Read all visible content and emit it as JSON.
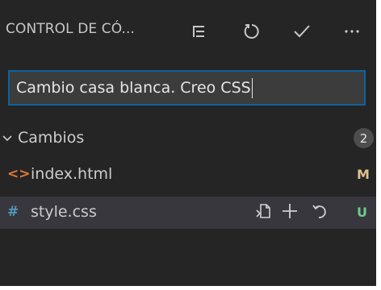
{
  "header": {
    "title": "CONTROL DE CÓ...",
    "actions": [
      {
        "name": "view-as-tree",
        "icon": "list-tree-icon"
      },
      {
        "name": "refresh",
        "icon": "refresh-icon"
      },
      {
        "name": "commit",
        "icon": "check-icon"
      },
      {
        "name": "more-actions",
        "icon": "ellipsis-icon"
      }
    ]
  },
  "commit_message": {
    "value": "Cambio casa blanca. Creo CSS"
  },
  "changes_group": {
    "label": "Cambios",
    "count": "2",
    "expanded": true
  },
  "files": [
    {
      "icon_glyph": "<>",
      "icon_color": "#e37933",
      "name": "index.html",
      "status": "M",
      "status_color": "#e2c08d",
      "selected": false
    },
    {
      "icon_glyph": "#",
      "icon_color": "#519aba",
      "name": "style.css",
      "status": "U",
      "status_color": "#73c991",
      "selected": true,
      "row_actions": [
        "open-file-icon",
        "stage-changes-icon",
        "discard-changes-icon"
      ]
    }
  ],
  "colors": {
    "panel_bg": "#252526",
    "input_bg": "#3c3c3c",
    "focus_border": "#0e639c",
    "selected_row": "#37373d"
  }
}
